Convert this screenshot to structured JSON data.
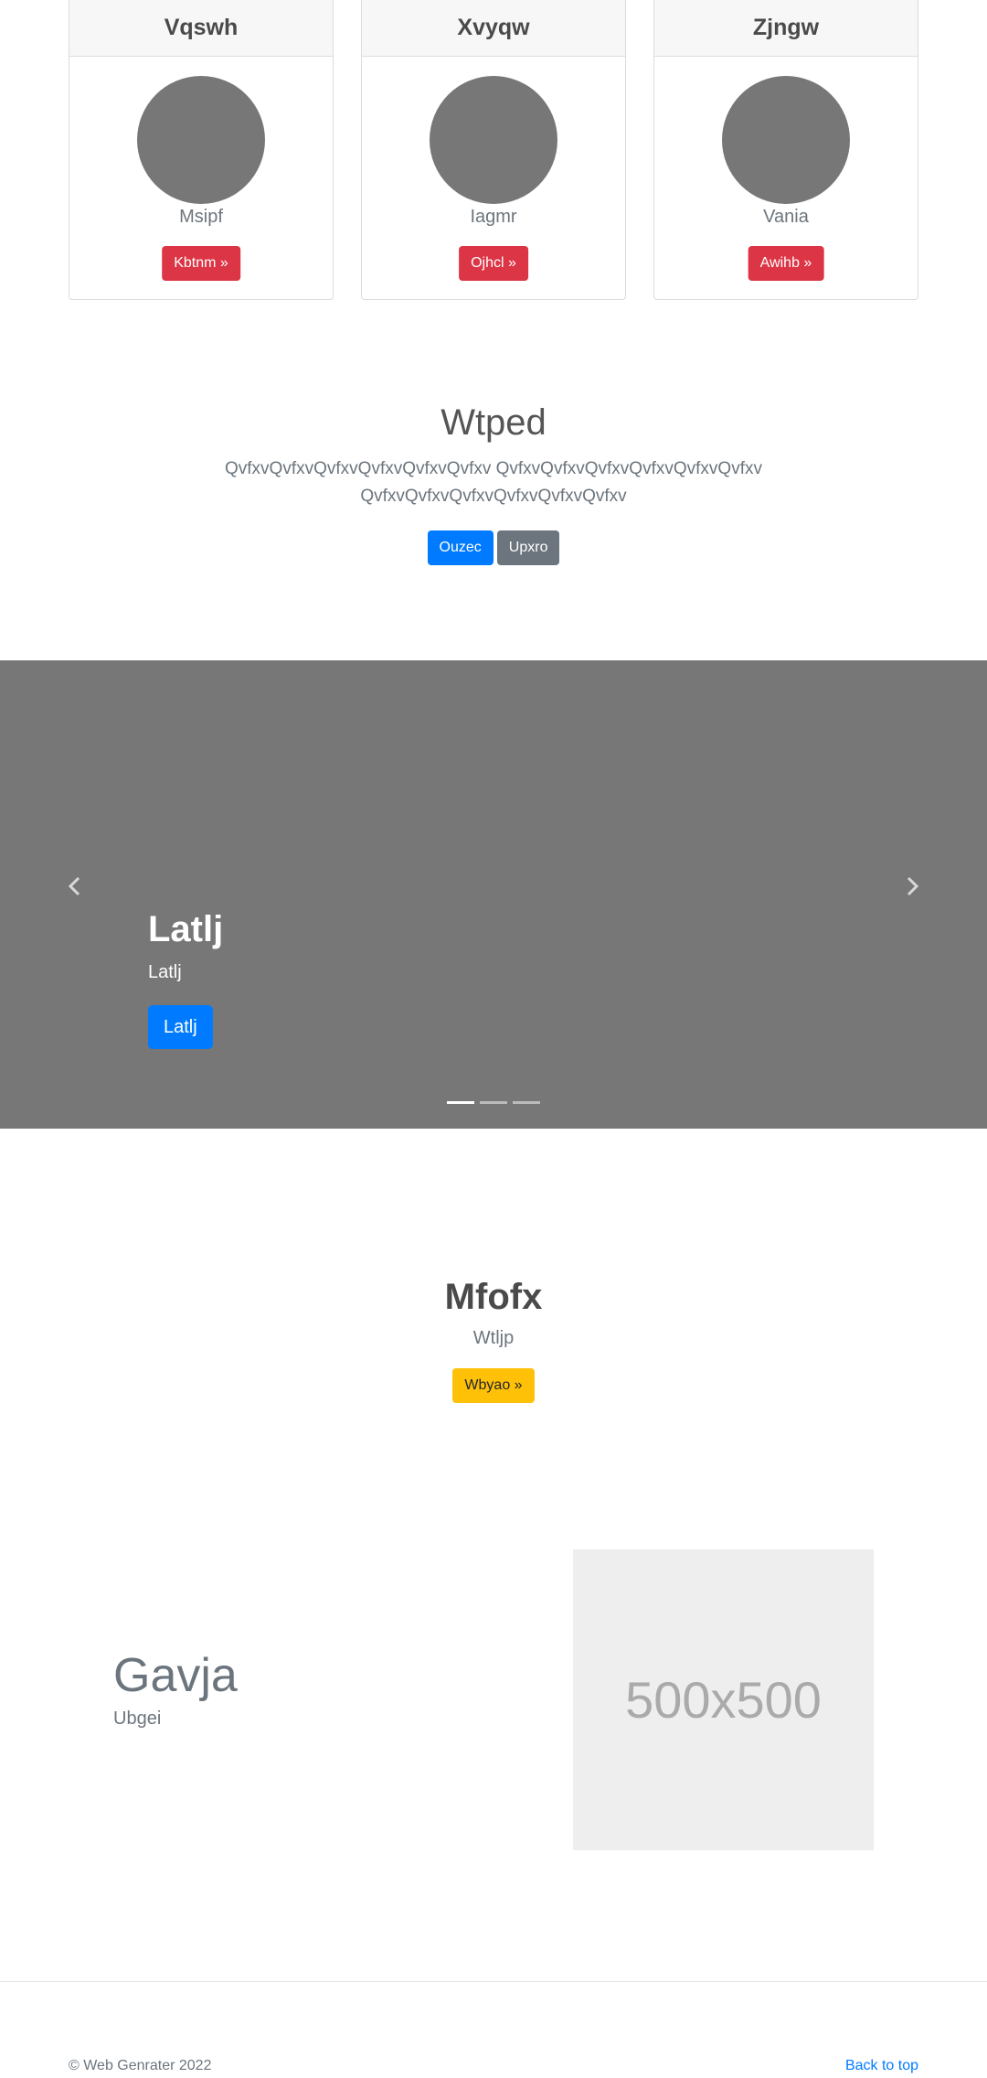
{
  "cards": [
    {
      "title": "Vqswh",
      "name": "Msipf",
      "button": "Kbtnm »"
    },
    {
      "title": "Xvyqw",
      "name": "Iagmr",
      "button": "Ojhcl »"
    },
    {
      "title": "Zjngw",
      "name": "Vania",
      "button": "Awihb »"
    }
  ],
  "hero": {
    "title": "Wtped",
    "lead": "QvfxvQvfxvQvfxvQvfxvQvfxvQvfxv QvfxvQvfxvQvfxvQvfxvQvfxvQvfxv QvfxvQvfxvQvfxvQvfxvQvfxvQvfxv",
    "primary_button": "Ouzec",
    "secondary_button": "Upxro"
  },
  "carousel": {
    "title": "Latlj",
    "text": "Latlj",
    "button": "Latlj",
    "indicator_count": 3,
    "active_index": 0
  },
  "featured": {
    "title": "Mfofx",
    "subtitle": "Wtljp",
    "button": "Wbyao »"
  },
  "split": {
    "title": "Gavja",
    "subtitle": "Ubgei",
    "image_placeholder": "500x500"
  },
  "footer": {
    "copyright": "© Web Genrater 2022",
    "back_to_top": "Back to top"
  },
  "colors": {
    "danger": "#dc3545",
    "primary": "#007bff",
    "secondary": "#6c757d",
    "warning": "#ffc107",
    "carousel_bg": "#777777"
  }
}
